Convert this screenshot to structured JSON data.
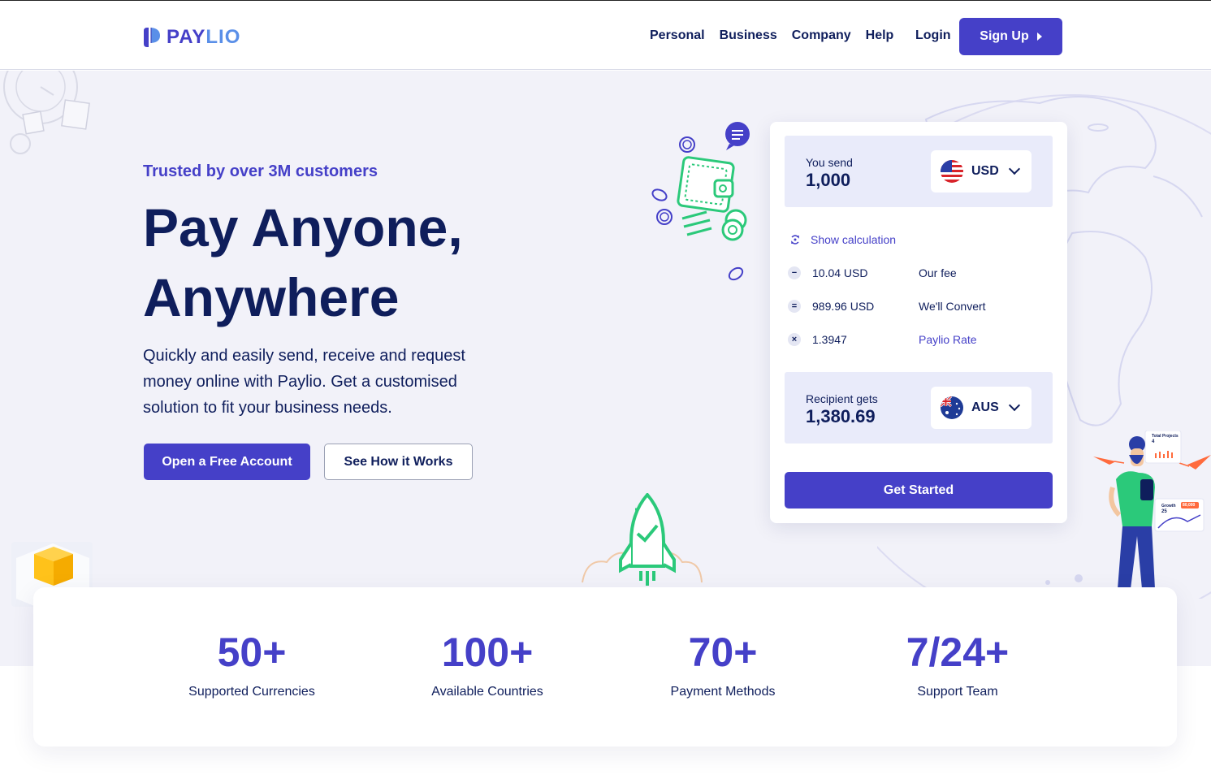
{
  "header": {
    "logo_pay": "PAY",
    "logo_lio": "LIO",
    "nav": [
      "Personal",
      "Business",
      "Company",
      "Help"
    ],
    "login": "Login",
    "signup": "Sign Up"
  },
  "hero": {
    "trusted": "Trusted by over 3M customers",
    "title_line1": "Pay Anyone,",
    "title_line2": "Anywhere",
    "description": "Quickly and easily send, receive and request money online with Paylio. Get a customised solution to fit your business needs.",
    "cta_primary": "Open a Free Account",
    "cta_secondary": "See How it Works"
  },
  "converter": {
    "send_label": "You send",
    "send_amount": "1,000",
    "send_currency": "USD",
    "show_calculation": "Show calculation",
    "rows": [
      {
        "symbol": "−",
        "value": "10.04 USD",
        "label": "Our fee"
      },
      {
        "symbol": "=",
        "value": "989.96 USD",
        "label": "We'll Convert"
      },
      {
        "symbol": "×",
        "value": "1.3947",
        "label": "Paylio Rate"
      }
    ],
    "receive_label": "Recipient gets",
    "receive_amount": "1,380.69",
    "receive_currency": "AUS",
    "get_started": "Get Started"
  },
  "stats": [
    {
      "number": "50+",
      "label": "Supported Currencies"
    },
    {
      "number": "100+",
      "label": "Available Countries"
    },
    {
      "number": "70+",
      "label": "Payment Methods"
    },
    {
      "number": "7/24+",
      "label": "Support Team"
    }
  ],
  "illustration_text": {
    "total_projects": "Total Projects",
    "total_projects_value": "4",
    "growth": "Growth",
    "growth_value": "25",
    "growth_badge": "80,000"
  },
  "colors": {
    "primary": "#4540c8",
    "navy": "#0f1e5c",
    "hero_bg": "#f2f2f9",
    "green": "#2bc97a"
  }
}
